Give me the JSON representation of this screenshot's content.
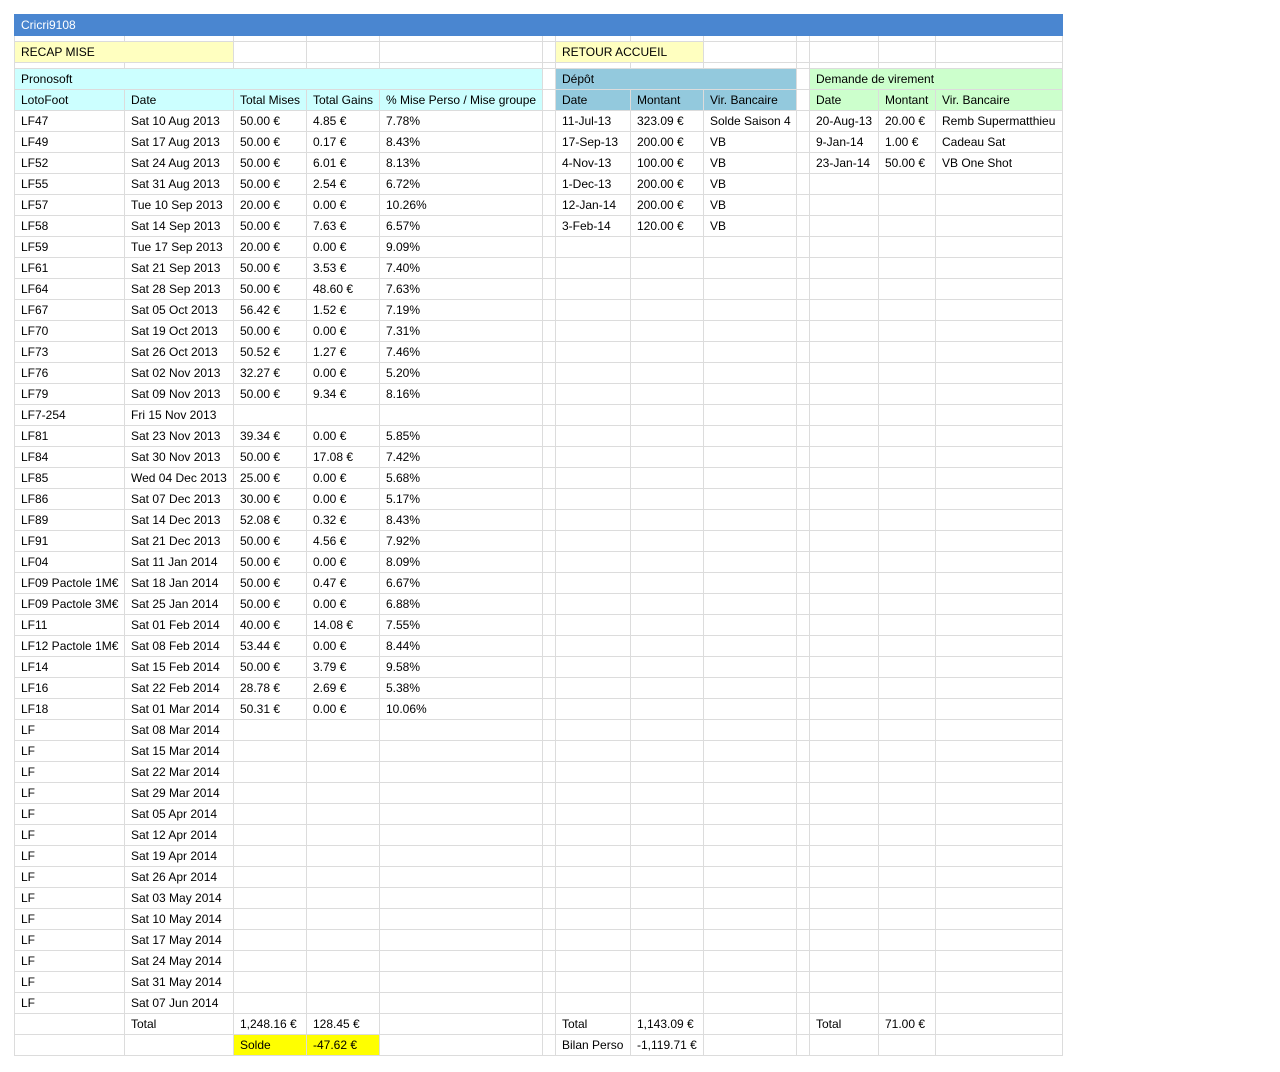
{
  "title": "Cricri9108",
  "buttons": {
    "recap": "RECAP MISE",
    "retour": "RETOUR ACCUEIL"
  },
  "pronosoft": {
    "section": "Pronosoft",
    "headers": [
      "LotoFoot",
      "Date",
      "Total Mises",
      "Total Gains",
      "% Mise Perso / Mise groupe"
    ],
    "rows": [
      [
        "LF47",
        "Sat 10 Aug 2013",
        "50.00 €",
        "4.85 €",
        "7.78%"
      ],
      [
        "LF49",
        "Sat 17 Aug 2013",
        "50.00 €",
        "0.17 €",
        "8.43%"
      ],
      [
        "LF52",
        "Sat 24 Aug 2013",
        "50.00 €",
        "6.01 €",
        "8.13%"
      ],
      [
        "LF55",
        "Sat 31 Aug 2013",
        "50.00 €",
        "2.54 €",
        "6.72%"
      ],
      [
        "LF57",
        "Tue 10 Sep 2013",
        "20.00 €",
        "0.00 €",
        "10.26%"
      ],
      [
        "LF58",
        "Sat 14 Sep 2013",
        "50.00 €",
        "7.63 €",
        "6.57%"
      ],
      [
        "LF59",
        "Tue 17 Sep 2013",
        "20.00 €",
        "0.00 €",
        "9.09%"
      ],
      [
        "LF61",
        "Sat 21 Sep 2013",
        "50.00 €",
        "3.53 €",
        "7.40%"
      ],
      [
        "LF64",
        "Sat 28 Sep 2013",
        "50.00 €",
        "48.60 €",
        "7.63%"
      ],
      [
        "LF67",
        "Sat 05 Oct 2013",
        "56.42 €",
        "1.52 €",
        "7.19%"
      ],
      [
        "LF70",
        "Sat 19 Oct 2013",
        "50.00 €",
        "0.00 €",
        "7.31%"
      ],
      [
        "LF73",
        "Sat 26 Oct 2013",
        "50.52 €",
        "1.27 €",
        "7.46%"
      ],
      [
        "LF76",
        "Sat 02 Nov 2013",
        "32.27 €",
        "0.00 €",
        "5.20%"
      ],
      [
        "LF79",
        "Sat 09 Nov 2013",
        "50.00 €",
        "9.34 €",
        "8.16%"
      ],
      [
        "LF7-254",
        "Fri 15 Nov 2013",
        "",
        "",
        ""
      ],
      [
        "LF81",
        "Sat 23 Nov 2013",
        "39.34 €",
        "0.00 €",
        "5.85%"
      ],
      [
        "LF84",
        "Sat 30 Nov 2013",
        "50.00 €",
        "17.08 €",
        "7.42%"
      ],
      [
        "LF85",
        "Wed 04 Dec 2013",
        "25.00 €",
        "0.00 €",
        "5.68%"
      ],
      [
        "LF86",
        "Sat 07 Dec 2013",
        "30.00 €",
        "0.00 €",
        "5.17%"
      ],
      [
        "LF89",
        "Sat 14 Dec 2013",
        "52.08 €",
        "0.32 €",
        "8.43%"
      ],
      [
        "LF91",
        "Sat 21 Dec 2013",
        "50.00 €",
        "4.56 €",
        "7.92%"
      ],
      [
        "LF04",
        "Sat 11 Jan 2014",
        "50.00 €",
        "0.00 €",
        "8.09%"
      ],
      [
        "LF09 Pactole 1M€",
        "Sat 18 Jan 2014",
        "50.00 €",
        "0.47 €",
        "6.67%"
      ],
      [
        "LF09 Pactole 3M€",
        "Sat 25 Jan 2014",
        "50.00 €",
        "0.00 €",
        "6.88%"
      ],
      [
        "LF11",
        "Sat 01 Feb 2014",
        "40.00 €",
        "14.08 €",
        "7.55%"
      ],
      [
        "LF12 Pactole 1M€",
        "Sat 08 Feb 2014",
        "53.44 €",
        "0.00 €",
        "8.44%"
      ],
      [
        "LF14",
        "Sat 15 Feb 2014",
        "50.00 €",
        "3.79 €",
        "9.58%"
      ],
      [
        "LF16",
        "Sat 22 Feb 2014",
        "28.78 €",
        "2.69 €",
        "5.38%"
      ],
      [
        "LF18",
        "Sat 01 Mar 2014",
        "50.31 €",
        "0.00 €",
        "10.06%"
      ],
      [
        "LF",
        "Sat 08 Mar 2014",
        "",
        "",
        ""
      ],
      [
        "LF",
        "Sat 15 Mar 2014",
        "",
        "",
        ""
      ],
      [
        "LF",
        "Sat 22 Mar 2014",
        "",
        "",
        ""
      ],
      [
        "LF",
        "Sat 29 Mar 2014",
        "",
        "",
        ""
      ],
      [
        "LF",
        "Sat 05 Apr 2014",
        "",
        "",
        ""
      ],
      [
        "LF",
        "Sat 12 Apr 2014",
        "",
        "",
        ""
      ],
      [
        "LF",
        "Sat 19 Apr 2014",
        "",
        "",
        ""
      ],
      [
        "LF",
        "Sat 26 Apr 2014",
        "",
        "",
        ""
      ],
      [
        "LF",
        "Sat 03 May 2014",
        "",
        "",
        ""
      ],
      [
        "LF",
        "Sat 10 May 2014",
        "",
        "",
        ""
      ],
      [
        "LF",
        "Sat 17 May 2014",
        "",
        "",
        ""
      ],
      [
        "LF",
        "Sat 24 May 2014",
        "",
        "",
        ""
      ],
      [
        "LF",
        "Sat 31 May 2014",
        "",
        "",
        ""
      ],
      [
        "LF",
        "Sat 07 Jun 2014",
        "",
        "",
        ""
      ]
    ],
    "total_label": "Total",
    "total_mises": "1,248.16 €",
    "total_gains": "128.45 €",
    "solde_label": "Solde",
    "solde_value": "-47.62 €"
  },
  "depot": {
    "section": "Dépôt",
    "headers": [
      "Date",
      "Montant",
      "Vir. Bancaire"
    ],
    "rows": [
      [
        "11-Jul-13",
        "323.09 €",
        "Solde Saison 4"
      ],
      [
        "17-Sep-13",
        "200.00 €",
        "VB"
      ],
      [
        "4-Nov-13",
        "100.00 €",
        "VB"
      ],
      [
        "1-Dec-13",
        "200.00 €",
        "VB"
      ],
      [
        "12-Jan-14",
        "200.00 €",
        "VB"
      ],
      [
        "3-Feb-14",
        "120.00 €",
        "VB"
      ]
    ],
    "total_label": "Total",
    "total_value": "1,143.09 €",
    "bilan_label": "Bilan Perso",
    "bilan_value": "-1,119.71 €"
  },
  "virement": {
    "section": "Demande de virement",
    "headers": [
      "Date",
      "Montant",
      "Vir. Bancaire"
    ],
    "rows": [
      [
        "20-Aug-13",
        "20.00 €",
        "Remb Supermatthieu"
      ],
      [
        "9-Jan-14",
        "1.00 €",
        "Cadeau Sat"
      ],
      [
        "23-Jan-14",
        "50.00 €",
        "VB One Shot"
      ]
    ],
    "total_label": "Total",
    "total_value": "71.00 €"
  },
  "colors": {
    "title_bar": "#4a86d0",
    "yellow_button": "#ffffc0",
    "pronosoft": "#ccffff",
    "depot": "#93c9dd",
    "virement": "#ccffcc",
    "solde_highlight": "#ffff00"
  }
}
